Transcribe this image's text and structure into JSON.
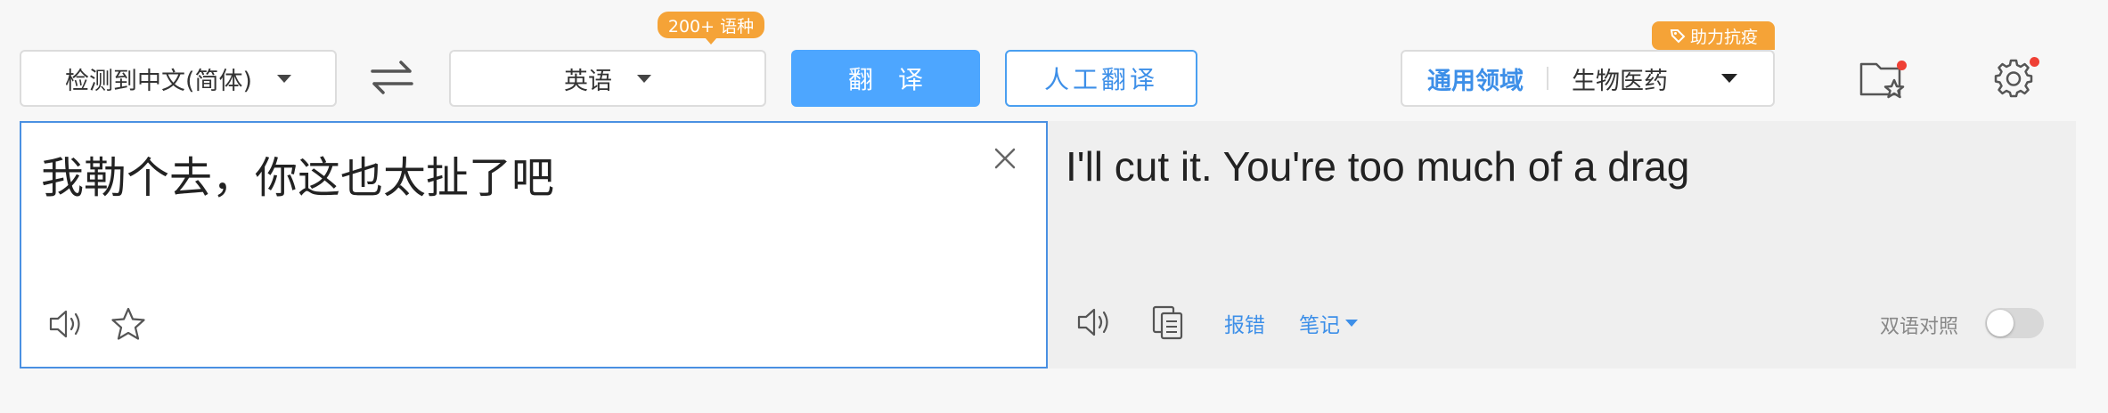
{
  "source_lang": {
    "label": "检测到中文(简体)"
  },
  "target_lang": {
    "label": "英语",
    "badge": "200+ 语种"
  },
  "actions": {
    "translate_label": "翻译",
    "human_translate_label": "人工翻译"
  },
  "domain": {
    "badge": "助力抗疫",
    "general_label": "通用领域",
    "selected_label": "生物医药"
  },
  "input": {
    "text": "我勒个去，你这也太扯了吧"
  },
  "output": {
    "text": "I'll cut it. You're too much of a drag",
    "report_label": "报错",
    "notes_label": "笔记",
    "bilingual_label": "双语对照",
    "bilingual_on": false
  },
  "colors": {
    "accent": "#4da6ff",
    "badge": "#f5a337",
    "notify_dot": "#ef4035"
  },
  "icons": {
    "swap": "swap-arrows-icon",
    "favorites": "folder-star-icon",
    "settings": "gear-icon",
    "clear": "close-icon",
    "speaker": "speaker-icon",
    "star": "star-icon",
    "copy": "copy-icon"
  }
}
